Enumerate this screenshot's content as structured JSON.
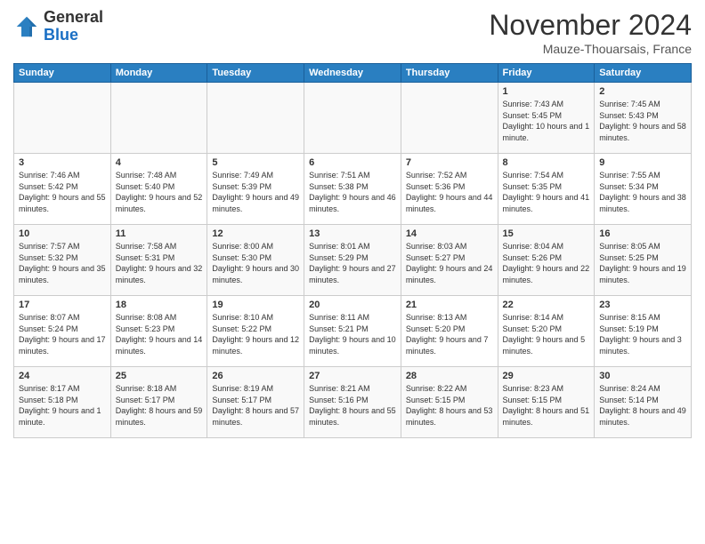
{
  "logo": {
    "line1": "General",
    "line2": "Blue"
  },
  "header": {
    "month": "November 2024",
    "location": "Mauze-Thouarsais, France"
  },
  "weekdays": [
    "Sunday",
    "Monday",
    "Tuesday",
    "Wednesday",
    "Thursday",
    "Friday",
    "Saturday"
  ],
  "weeks": [
    [
      {
        "day": "",
        "info": ""
      },
      {
        "day": "",
        "info": ""
      },
      {
        "day": "",
        "info": ""
      },
      {
        "day": "",
        "info": ""
      },
      {
        "day": "",
        "info": ""
      },
      {
        "day": "1",
        "info": "Sunrise: 7:43 AM\nSunset: 5:45 PM\nDaylight: 10 hours and 1 minute."
      },
      {
        "day": "2",
        "info": "Sunrise: 7:45 AM\nSunset: 5:43 PM\nDaylight: 9 hours and 58 minutes."
      }
    ],
    [
      {
        "day": "3",
        "info": "Sunrise: 7:46 AM\nSunset: 5:42 PM\nDaylight: 9 hours and 55 minutes."
      },
      {
        "day": "4",
        "info": "Sunrise: 7:48 AM\nSunset: 5:40 PM\nDaylight: 9 hours and 52 minutes."
      },
      {
        "day": "5",
        "info": "Sunrise: 7:49 AM\nSunset: 5:39 PM\nDaylight: 9 hours and 49 minutes."
      },
      {
        "day": "6",
        "info": "Sunrise: 7:51 AM\nSunset: 5:38 PM\nDaylight: 9 hours and 46 minutes."
      },
      {
        "day": "7",
        "info": "Sunrise: 7:52 AM\nSunset: 5:36 PM\nDaylight: 9 hours and 44 minutes."
      },
      {
        "day": "8",
        "info": "Sunrise: 7:54 AM\nSunset: 5:35 PM\nDaylight: 9 hours and 41 minutes."
      },
      {
        "day": "9",
        "info": "Sunrise: 7:55 AM\nSunset: 5:34 PM\nDaylight: 9 hours and 38 minutes."
      }
    ],
    [
      {
        "day": "10",
        "info": "Sunrise: 7:57 AM\nSunset: 5:32 PM\nDaylight: 9 hours and 35 minutes."
      },
      {
        "day": "11",
        "info": "Sunrise: 7:58 AM\nSunset: 5:31 PM\nDaylight: 9 hours and 32 minutes."
      },
      {
        "day": "12",
        "info": "Sunrise: 8:00 AM\nSunset: 5:30 PM\nDaylight: 9 hours and 30 minutes."
      },
      {
        "day": "13",
        "info": "Sunrise: 8:01 AM\nSunset: 5:29 PM\nDaylight: 9 hours and 27 minutes."
      },
      {
        "day": "14",
        "info": "Sunrise: 8:03 AM\nSunset: 5:27 PM\nDaylight: 9 hours and 24 minutes."
      },
      {
        "day": "15",
        "info": "Sunrise: 8:04 AM\nSunset: 5:26 PM\nDaylight: 9 hours and 22 minutes."
      },
      {
        "day": "16",
        "info": "Sunrise: 8:05 AM\nSunset: 5:25 PM\nDaylight: 9 hours and 19 minutes."
      }
    ],
    [
      {
        "day": "17",
        "info": "Sunrise: 8:07 AM\nSunset: 5:24 PM\nDaylight: 9 hours and 17 minutes."
      },
      {
        "day": "18",
        "info": "Sunrise: 8:08 AM\nSunset: 5:23 PM\nDaylight: 9 hours and 14 minutes."
      },
      {
        "day": "19",
        "info": "Sunrise: 8:10 AM\nSunset: 5:22 PM\nDaylight: 9 hours and 12 minutes."
      },
      {
        "day": "20",
        "info": "Sunrise: 8:11 AM\nSunset: 5:21 PM\nDaylight: 9 hours and 10 minutes."
      },
      {
        "day": "21",
        "info": "Sunrise: 8:13 AM\nSunset: 5:20 PM\nDaylight: 9 hours and 7 minutes."
      },
      {
        "day": "22",
        "info": "Sunrise: 8:14 AM\nSunset: 5:20 PM\nDaylight: 9 hours and 5 minutes."
      },
      {
        "day": "23",
        "info": "Sunrise: 8:15 AM\nSunset: 5:19 PM\nDaylight: 9 hours and 3 minutes."
      }
    ],
    [
      {
        "day": "24",
        "info": "Sunrise: 8:17 AM\nSunset: 5:18 PM\nDaylight: 9 hours and 1 minute."
      },
      {
        "day": "25",
        "info": "Sunrise: 8:18 AM\nSunset: 5:17 PM\nDaylight: 8 hours and 59 minutes."
      },
      {
        "day": "26",
        "info": "Sunrise: 8:19 AM\nSunset: 5:17 PM\nDaylight: 8 hours and 57 minutes."
      },
      {
        "day": "27",
        "info": "Sunrise: 8:21 AM\nSunset: 5:16 PM\nDaylight: 8 hours and 55 minutes."
      },
      {
        "day": "28",
        "info": "Sunrise: 8:22 AM\nSunset: 5:15 PM\nDaylight: 8 hours and 53 minutes."
      },
      {
        "day": "29",
        "info": "Sunrise: 8:23 AM\nSunset: 5:15 PM\nDaylight: 8 hours and 51 minutes."
      },
      {
        "day": "30",
        "info": "Sunrise: 8:24 AM\nSunset: 5:14 PM\nDaylight: 8 hours and 49 minutes."
      }
    ]
  ]
}
